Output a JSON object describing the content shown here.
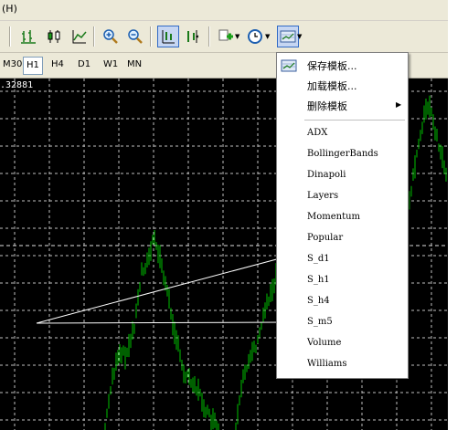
{
  "menubar": {
    "help_label": "(H)"
  },
  "toolbar": {
    "buttons": [
      "bar-chart-icon",
      "candlestick-icon",
      "line-chart-icon",
      "zoom-in-icon",
      "zoom-out-icon",
      "auto-scroll-icon",
      "chart-shift-icon",
      "add-indicator-icon",
      "periods-clock-icon",
      "templates-icon"
    ]
  },
  "timeframes": [
    {
      "label": "M30",
      "active": false
    },
    {
      "label": "H1",
      "active": true
    },
    {
      "label": "H4",
      "active": false
    },
    {
      "label": "D1",
      "active": false
    },
    {
      "label": "W1",
      "active": false
    },
    {
      "label": "MN",
      "active": false
    }
  ],
  "chart": {
    "price_label": ".32881",
    "background": "#000000",
    "candle_color": "#00c000",
    "grid_color": "#c0c0c0"
  },
  "template_menu": {
    "save_label": "保存模板...",
    "load_label": "加载模板...",
    "delete_label": "删除模板",
    "templates": [
      "ADX",
      "BollingerBands",
      "Dinapoli",
      "Layers",
      "Momentum",
      "Popular",
      "S_d1",
      "S_h1",
      "S_h4",
      "S_m5",
      "Volume",
      "Williams"
    ]
  }
}
